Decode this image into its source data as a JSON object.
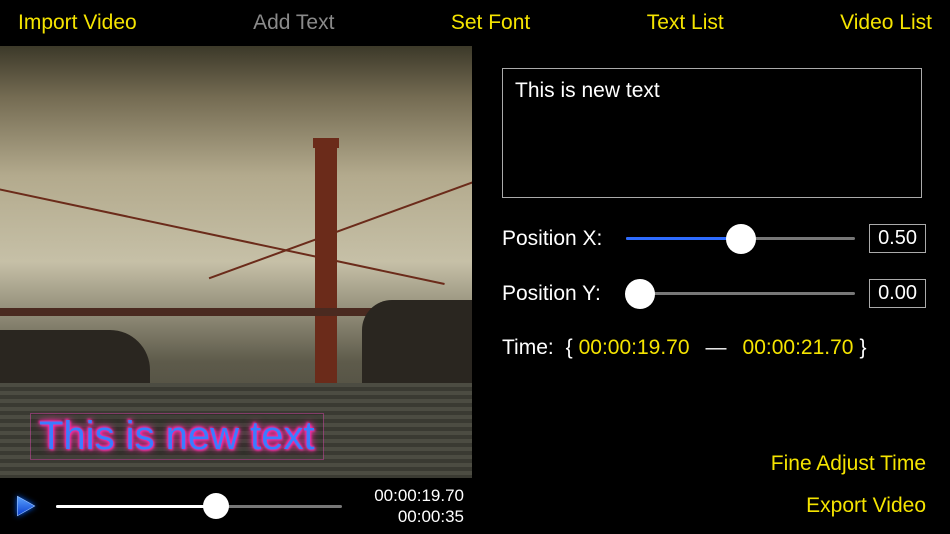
{
  "topbar": {
    "import": "Import Video",
    "add_text": "Add Text",
    "set_font": "Set Font",
    "text_list": "Text List",
    "video_list": "Video List"
  },
  "preview": {
    "overlay_text": "This is new text"
  },
  "transport": {
    "current": "00:00:19.70",
    "total": "00:00:35",
    "progress_pct": 56
  },
  "editor": {
    "text_value": "This is new text",
    "pos_x": {
      "label": "Position X:",
      "value": "0.50",
      "pct": 50
    },
    "pos_y": {
      "label": "Position Y:",
      "value": "0.00",
      "pct": 0
    },
    "time": {
      "label": "Time:",
      "start": "00:00:19.70",
      "end": "00:00:21.70"
    },
    "fine_adjust": "Fine Adjust Time",
    "export": "Export Video"
  }
}
